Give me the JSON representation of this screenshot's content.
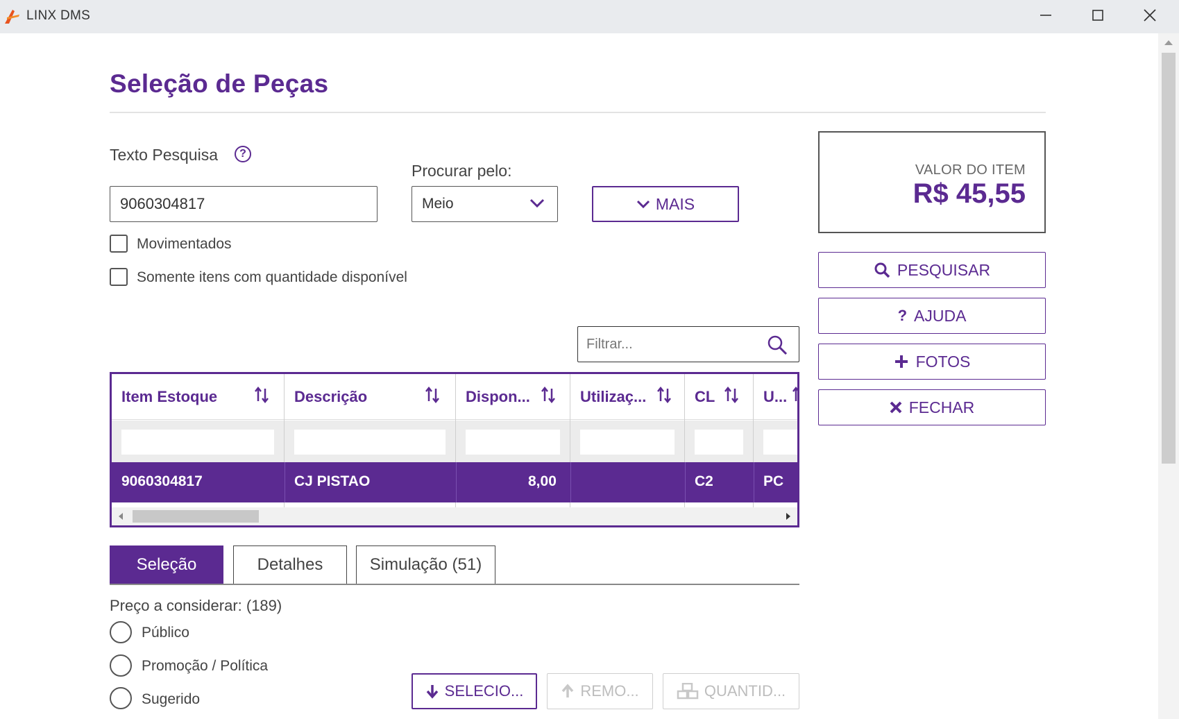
{
  "window": {
    "title": "LINX DMS"
  },
  "page": {
    "title": "Seleção de Peças"
  },
  "search": {
    "label": "Texto Pesquisa",
    "value": "9060304817",
    "procurar_label": "Procurar pelo:",
    "procurar_value": "Meio",
    "mais_label": "MAIS",
    "checkbox_movimentados": "Movimentados",
    "checkbox_somente": "Somente itens com quantidade disponível"
  },
  "valor": {
    "caption": "VALOR DO ITEM",
    "amount": "R$ 45,55"
  },
  "actions": {
    "pesquisar": "PESQUISAR",
    "ajuda": "AJUDA",
    "fotos": "FOTOS",
    "fechar": "FECHAR"
  },
  "filter": {
    "placeholder": "Filtrar..."
  },
  "grid": {
    "columns": [
      "Item Estoque",
      "Descrição",
      "Dispon...",
      "Utilizaç...",
      "CL",
      "U..."
    ],
    "rows": [
      [
        "9060304817",
        "CJ PISTAO",
        "8,00",
        "",
        "C2",
        "PC"
      ]
    ]
  },
  "tabs": [
    "Seleção",
    "Detalhes",
    "Simulação (51)"
  ],
  "price": {
    "label": "Preço a considerar: (189)",
    "options": [
      "Público",
      "Promoção / Política",
      "Sugerido"
    ]
  },
  "bottom_buttons": {
    "selecionar": "SELECIO...",
    "remover": "REMO...",
    "quantidade": "QUANTID..."
  },
  "colors": {
    "accent": "#5b2a91",
    "disabled": "#bdbdbd"
  }
}
